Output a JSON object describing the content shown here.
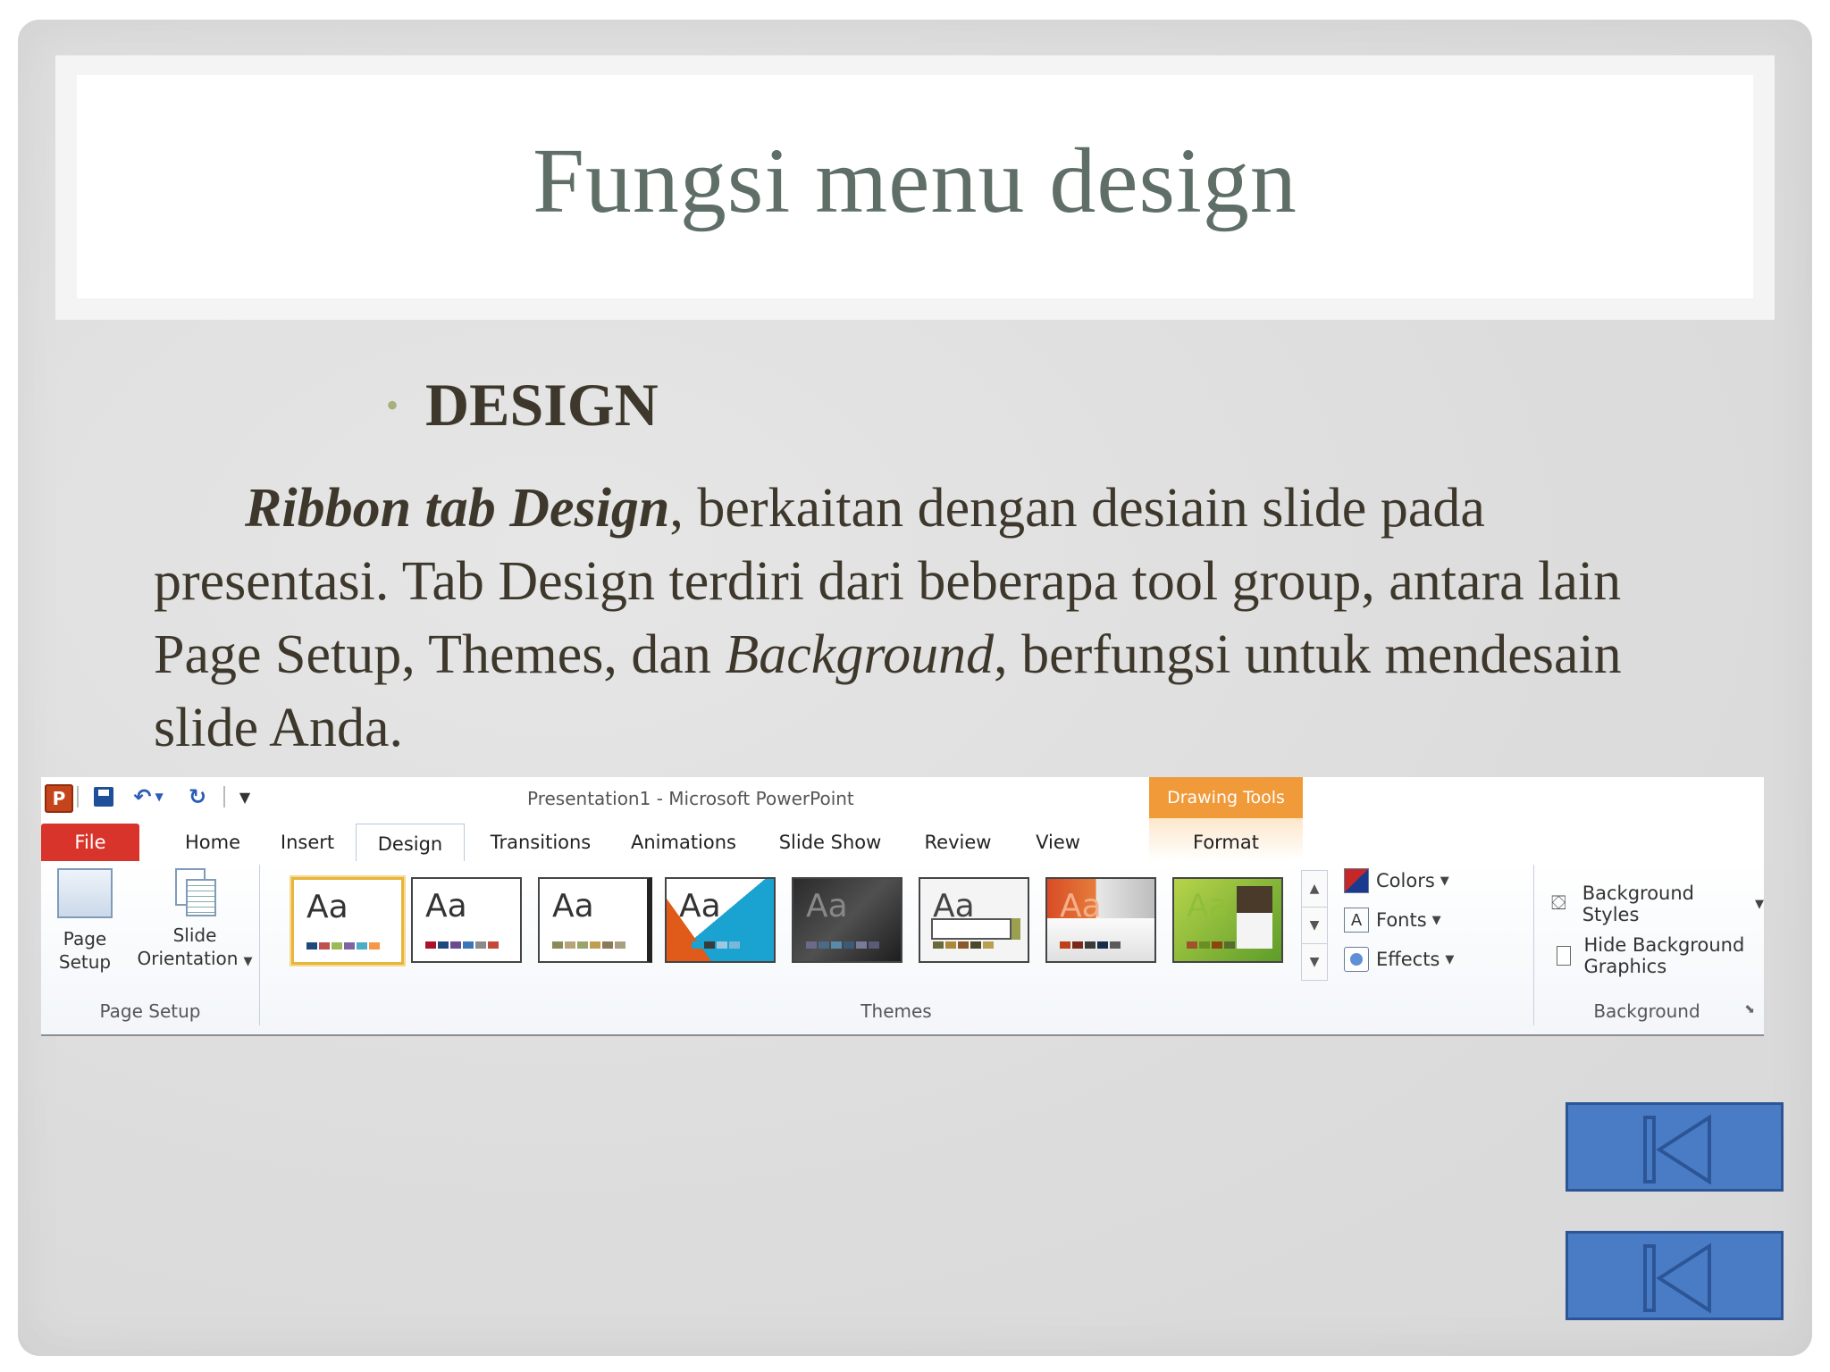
{
  "slide": {
    "title": "Fungsi menu design",
    "bullet": "DESIGN",
    "paragraph": {
      "p1_bold_italic": "Ribbon tab Design",
      "p1_rest": ", berkaitan dengan desiain slide pada presentasi. Tab Design terdiri dari beberapa tool group, antara lain Page Setup, Themes, dan ",
      "p1_italic": "Background",
      "p1_end": ", berfungsi untuk mendesain slide Anda."
    }
  },
  "ribbon": {
    "window_title": "Presentation1  -  Microsoft PowerPoint",
    "contextual_header": "Drawing Tools",
    "app_icon": "P",
    "tabs": {
      "file": "File",
      "home": "Home",
      "insert": "Insert",
      "design": "Design",
      "transitions": "Transitions",
      "animations": "Animations",
      "slide_show": "Slide Show",
      "review": "Review",
      "view": "View",
      "format": "Format"
    },
    "page_setup": {
      "page_setup_btn_line1": "Page",
      "page_setup_btn_line2": "Setup",
      "orientation_btn_line1": "Slide",
      "orientation_btn_line2": "Orientation",
      "group_label": "Page Setup"
    },
    "themes": {
      "sample_text": "Aa",
      "group_label": "Themes",
      "colors": "Colors",
      "fonts": "Fonts",
      "effects": "Effects",
      "fonts_icon": "A"
    },
    "background": {
      "styles": "Background Styles",
      "hide_graphics": "Hide Background Graphics",
      "hide_graphics_checked": false,
      "group_label": "Background"
    }
  },
  "nav": {
    "buttons": [
      "first-slide-button",
      "previous-slide-button"
    ],
    "color": "#4a7cc6"
  }
}
